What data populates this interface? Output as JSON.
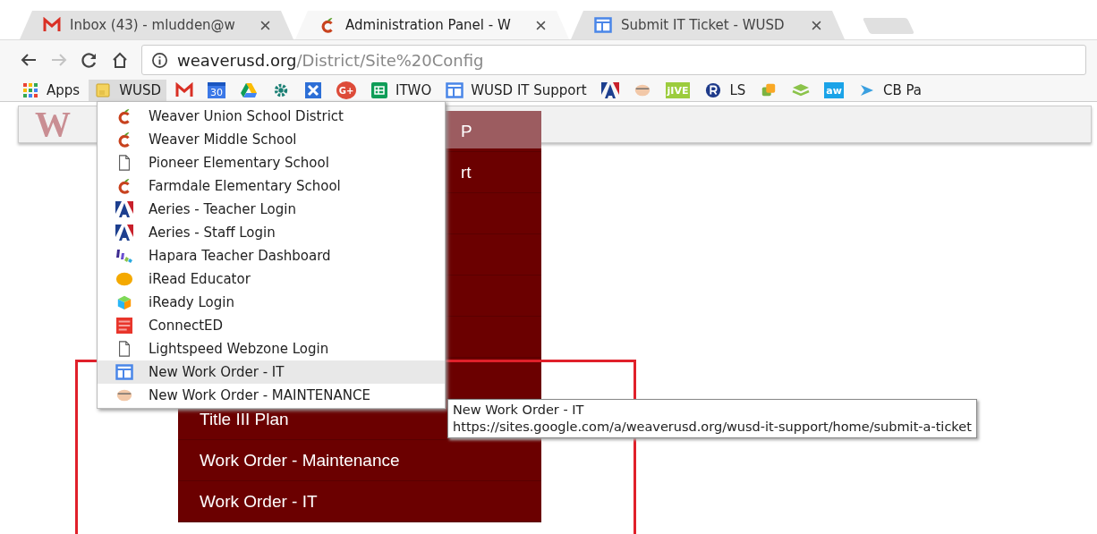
{
  "tabs": [
    {
      "title": "Inbox (43) - mludden@w",
      "kind": "gmail",
      "selected": false
    },
    {
      "title": "Administration Panel - W",
      "kind": "apple",
      "selected": true
    },
    {
      "title": "Submit IT Ticket - WUSD",
      "kind": "sites",
      "selected": false
    }
  ],
  "address": {
    "host": "weaverusd.org",
    "path": "/District/Site%20Config"
  },
  "nav": {
    "back_disabled": false,
    "forward_disabled": true
  },
  "bookmarks": [
    {
      "kind": "apps",
      "label": "Apps",
      "selected": false
    },
    {
      "kind": "folder",
      "label": "WUSD",
      "selected": true
    },
    {
      "kind": "gmail",
      "selected": false
    },
    {
      "kind": "calendar",
      "icon_text": "30",
      "selected": false
    },
    {
      "kind": "drive",
      "selected": false
    },
    {
      "kind": "gear",
      "selected": false
    },
    {
      "kind": "xbox",
      "selected": false
    },
    {
      "kind": "gplus",
      "icon_text": "G+",
      "selected": false
    },
    {
      "kind": "sheet",
      "label": "ITWO",
      "selected": false
    },
    {
      "kind": "sites",
      "label": "WUSD IT Support",
      "selected": false
    },
    {
      "kind": "aeries",
      "selected": false
    },
    {
      "kind": "face",
      "selected": false
    },
    {
      "kind": "jive",
      "icon_text": "jIVE",
      "selected": false
    },
    {
      "kind": "r",
      "label": "LS",
      "selected": false
    },
    {
      "kind": "vm",
      "selected": false
    },
    {
      "kind": "layers",
      "selected": false
    },
    {
      "kind": "aw",
      "icon_text": "aw",
      "selected": false
    },
    {
      "kind": "play",
      "label": "CB Pa",
      "selected": false
    }
  ],
  "page": {
    "logo": "W",
    "menu": [
      {
        "kind": "partial",
        "text": "P"
      },
      {
        "kind": "partial",
        "text": "rt"
      },
      {
        "kind": "blank"
      },
      {
        "kind": "blank"
      },
      {
        "kind": "blank"
      },
      {
        "kind": "blank"
      },
      {
        "kind": "blank"
      },
      {
        "kind": "full",
        "text": "Title III Plan"
      },
      {
        "kind": "full",
        "text": "Work Order - Maintenance"
      },
      {
        "kind": "full",
        "text": "Work Order - IT"
      }
    ]
  },
  "folder_menu": [
    {
      "kind": "apple",
      "label": "Weaver Union School District",
      "selected": false
    },
    {
      "kind": "apple",
      "label": "Weaver Middle School",
      "selected": false
    },
    {
      "kind": "doc",
      "label": "Pioneer Elementary School",
      "selected": false
    },
    {
      "kind": "apple",
      "label": "Farmdale Elementary School",
      "selected": false
    },
    {
      "kind": "aeries",
      "label": "Aeries - Teacher Login",
      "selected": false
    },
    {
      "kind": "aeries",
      "label": "Aeries - Staff Login",
      "selected": false
    },
    {
      "kind": "hapara",
      "label": "Hapara Teacher Dashboard",
      "selected": false
    },
    {
      "kind": "circle",
      "label": "iRead Educator",
      "selected": false
    },
    {
      "kind": "cube",
      "label": "iReady Login",
      "selected": false
    },
    {
      "kind": "mcgraw",
      "label": "ConnectED",
      "selected": false
    },
    {
      "kind": "doc",
      "label": "Lightspeed Webzone Login",
      "selected": false
    },
    {
      "kind": "sites",
      "label": "New Work Order - IT",
      "selected": true
    },
    {
      "kind": "face",
      "label": "New Work Order - MAINTENANCE",
      "selected": false
    }
  ],
  "tooltip": {
    "title": "New Work Order - IT",
    "url": "https://sites.google.com/a/weaverusd.org/wusd-it-support/home/submit-a-ticket"
  },
  "annotation": {
    "color": "#e0202a"
  }
}
